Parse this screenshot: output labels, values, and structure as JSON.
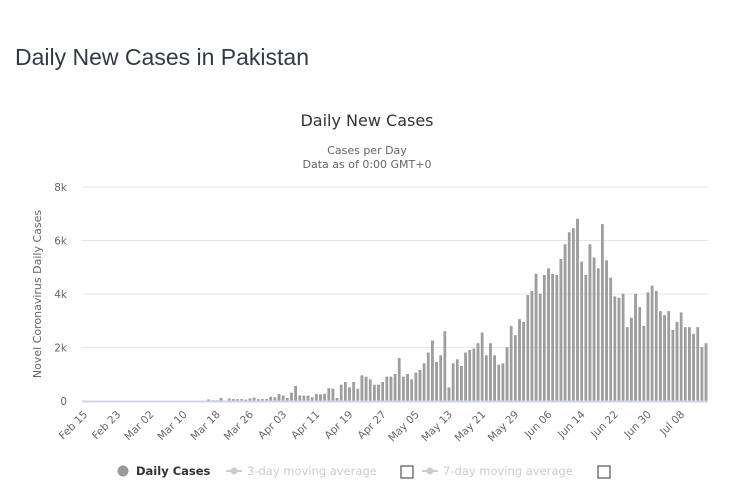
{
  "page": {
    "title": "Daily New Cases in Pakistan"
  },
  "chart_data": {
    "type": "bar",
    "title": "Daily New Cases",
    "subtitle": [
      "Cases per Day",
      "Data as of 0:00 GMT+0"
    ],
    "xlabel": "",
    "ylabel": "Novel Coronavirus Daily Cases",
    "ylim": [
      0,
      8000
    ],
    "yticks": [
      0,
      2000,
      4000,
      6000,
      8000
    ],
    "ytick_labels": [
      "0",
      "2k",
      "4k",
      "6k",
      "8k"
    ],
    "grid": true,
    "start_date": "Feb 15",
    "xtick_labels": [
      "Feb 15",
      "Feb 23",
      "Mar 02",
      "Mar 10",
      "Mar 18",
      "Mar 26",
      "Apr 03",
      "Apr 11",
      "Apr 19",
      "Apr 27",
      "May 05",
      "May 13",
      "May 21",
      "May 29",
      "Jun 06",
      "Jun 14",
      "Jun 22",
      "Jun 30",
      "Jul 08"
    ],
    "xtick_interval_days": 8,
    "series": [
      {
        "name": "Daily Cases",
        "color": "#999999",
        "values": [
          0,
          0,
          0,
          0,
          0,
          0,
          0,
          0,
          0,
          0,
          0,
          0,
          0,
          0,
          0,
          0,
          0,
          0,
          0,
          0,
          0,
          0,
          0,
          0,
          0,
          0,
          0,
          0,
          0,
          0,
          50,
          20,
          20,
          100,
          0,
          80,
          60,
          60,
          60,
          40,
          90,
          120,
          60,
          60,
          60,
          150,
          130,
          250,
          200,
          100,
          300,
          550,
          200,
          190,
          190,
          130,
          250,
          240,
          260,
          470,
          450,
          100,
          600,
          700,
          500,
          700,
          450,
          950,
          900,
          800,
          600,
          600,
          700,
          900,
          900,
          1000,
          1600,
          900,
          1000,
          800,
          1050,
          1150,
          1400,
          1800,
          2250,
          1450,
          1700,
          2600,
          500,
          1400,
          1550,
          1300,
          1800,
          1900,
          1950,
          2150,
          2550,
          1700,
          2150,
          1700,
          1350,
          1400,
          2000,
          2800,
          2450,
          3050,
          2950,
          3950,
          4100,
          4750,
          4000,
          4700,
          4950,
          4750,
          4700,
          5300,
          5850,
          6300,
          6450,
          6800,
          5200,
          4700,
          5850,
          5350,
          4950,
          6600,
          5250,
          4600,
          3900,
          3850,
          4000,
          2750,
          3100,
          4000,
          3500,
          2800,
          4050,
          4300,
          4100,
          3350,
          3200,
          3350,
          2650,
          2950,
          3300,
          2750,
          2750,
          2500,
          2750,
          2000,
          2150
        ]
      },
      {
        "name": "3-day moving average",
        "visible": false
      },
      {
        "name": "7-day moving average",
        "visible": false
      }
    ],
    "legend": {
      "position": "bottom-center",
      "items": [
        {
          "label": "Daily Cases",
          "enabled": true,
          "color": "#999999"
        },
        {
          "label": "3-day moving average",
          "enabled": false,
          "checkbox": false
        },
        {
          "label": "7-day moving average",
          "enabled": false,
          "checkbox": false
        }
      ]
    }
  },
  "colors": {
    "bar": "#a0a0a0",
    "bar_edge": "#8a8a8a",
    "grid": "#e6e6e6",
    "axis": "#ccd6eb",
    "legend_active": "#333333",
    "legend_inactive": "#cccccc"
  }
}
